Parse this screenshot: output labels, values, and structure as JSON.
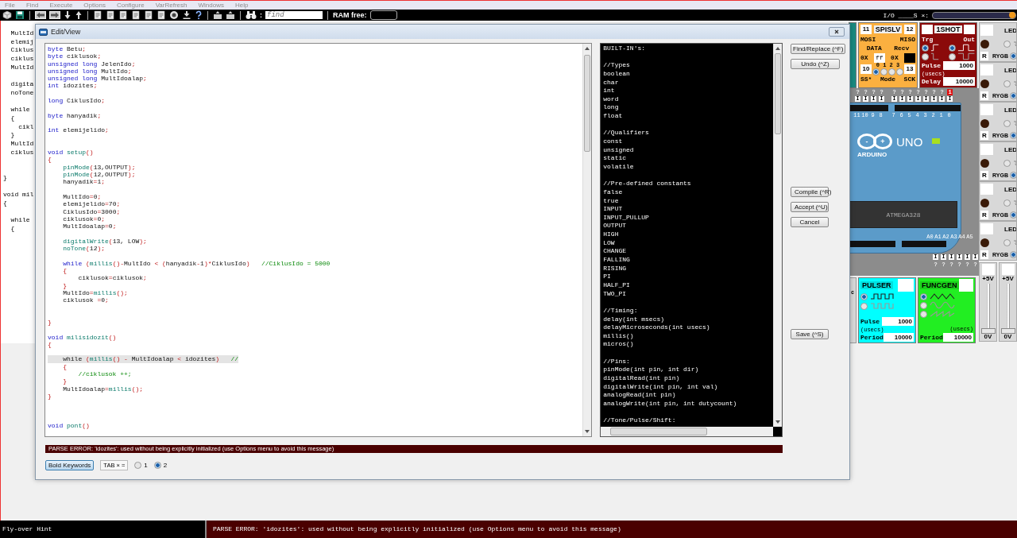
{
  "menu_bar": {
    "items": [
      {
        "label": "File",
        "disabled": true
      },
      {
        "label": "Find",
        "disabled": true
      },
      {
        "label": "Execute",
        "disabled": true
      },
      {
        "label": "Options",
        "disabled": true
      },
      {
        "label": "Configure",
        "disabled": true
      },
      {
        "label": "VarRefresh",
        "disabled": true
      },
      {
        "label": "Windows",
        "disabled": true
      },
      {
        "label": "Help",
        "disabled": true
      }
    ]
  },
  "toolbar": {
    "icons": [
      {
        "kind": "cube"
      },
      {
        "kind": "disk"
      },
      {
        "kind": "sep"
      },
      {
        "kind": "arrow-left"
      },
      {
        "kind": "arrow-right"
      },
      {
        "kind": "step-down"
      },
      {
        "kind": "step-up"
      },
      {
        "kind": "sep"
      },
      {
        "kind": "document"
      },
      {
        "kind": "document"
      },
      {
        "kind": "document"
      },
      {
        "kind": "document"
      },
      {
        "kind": "document"
      },
      {
        "kind": "document"
      },
      {
        "kind": "disc"
      },
      {
        "kind": "download"
      },
      {
        "kind": "help"
      },
      {
        "kind": "sep"
      },
      {
        "kind": "document-arrow"
      },
      {
        "kind": "document-arrow"
      },
      {
        "kind": "sep"
      },
      {
        "kind": "binoculars"
      }
    ],
    "find_colon": ":",
    "find_field": {
      "placeholder": "find"
    },
    "ram_label": "RAM free:",
    "io_label": "I/O ____S ×:",
    "io_slider": {
      "level": 1
    }
  },
  "background_code": {
    "lines": [
      {
        "kind": "code",
        "text": "  MultId"
      },
      {
        "kind": "code",
        "text": "  elemij"
      },
      {
        "kind": "code",
        "text": "  Ciklus"
      },
      {
        "kind": "code",
        "text": "  ciklus"
      },
      {
        "kind": "code",
        "text": "  MultId"
      },
      {
        "kind": "blank"
      },
      {
        "kind": "code",
        "text": "  digita"
      },
      {
        "kind": "code",
        "text": "  noTone"
      },
      {
        "kind": "blank"
      },
      {
        "kind": "code",
        "text": "  while"
      },
      {
        "kind": "code",
        "text": "  {"
      },
      {
        "kind": "code",
        "text": "    cikl"
      },
      {
        "kind": "code",
        "text": "  }"
      },
      {
        "kind": "code",
        "text": "  MultId"
      },
      {
        "kind": "code",
        "text": "  ciklus"
      },
      {
        "kind": "blank"
      },
      {
        "kind": "blank"
      },
      {
        "kind": "code",
        "text": "}"
      },
      {
        "kind": "blank"
      },
      {
        "kind": "code",
        "text": "void mil"
      },
      {
        "kind": "code",
        "text": "{"
      },
      {
        "kind": "blank"
      },
      {
        "kind": "code",
        "text": "  while"
      },
      {
        "kind": "code",
        "text": "  {"
      }
    ]
  },
  "edit_dialog": {
    "title": "Edit/View",
    "code_lines": [
      {
        "kind": "code",
        "current": false,
        "segments": [
          {
            "kind": "kw",
            "text": "byte"
          },
          {
            "kind": "tx",
            "text": " Betu"
          },
          {
            "kind": "op",
            "text": ";"
          }
        ]
      },
      {
        "kind": "code",
        "current": false,
        "segments": [
          {
            "kind": "kw",
            "text": "byte"
          },
          {
            "kind": "tx",
            "text": " ciklusok"
          },
          {
            "kind": "op",
            "text": ";"
          }
        ]
      },
      {
        "kind": "code",
        "current": false,
        "segments": [
          {
            "kind": "kw",
            "text": "unsigned long"
          },
          {
            "kind": "tx",
            "text": " JelenIdo"
          },
          {
            "kind": "op",
            "text": ";"
          }
        ]
      },
      {
        "kind": "code",
        "current": false,
        "segments": [
          {
            "kind": "kw",
            "text": "unsigned long"
          },
          {
            "kind": "tx",
            "text": " MultIdo"
          },
          {
            "kind": "op",
            "text": ";"
          }
        ]
      },
      {
        "kind": "code",
        "current": false,
        "segments": [
          {
            "kind": "kw",
            "text": "unsigned long"
          },
          {
            "kind": "tx",
            "text": " MultIdoalap"
          },
          {
            "kind": "op",
            "text": ";"
          }
        ]
      },
      {
        "kind": "code",
        "current": false,
        "segments": [
          {
            "kind": "kw",
            "text": "int"
          },
          {
            "kind": "tx",
            "text": " idozites"
          },
          {
            "kind": "op",
            "text": ";"
          }
        ]
      },
      {
        "kind": "blank"
      },
      {
        "kind": "code",
        "current": false,
        "segments": [
          {
            "kind": "kw",
            "text": "long"
          },
          {
            "kind": "tx",
            "text": " CiklusIdo"
          },
          {
            "kind": "op",
            "text": ";"
          }
        ]
      },
      {
        "kind": "blank"
      },
      {
        "kind": "code",
        "current": false,
        "segments": [
          {
            "kind": "kw",
            "text": "byte"
          },
          {
            "kind": "tx",
            "text": " hanyadik"
          },
          {
            "kind": "op",
            "text": ";"
          }
        ]
      },
      {
        "kind": "blank"
      },
      {
        "kind": "code",
        "current": false,
        "segments": [
          {
            "kind": "kw",
            "text": "int"
          },
          {
            "kind": "tx",
            "text": " elemijelido"
          },
          {
            "kind": "op",
            "text": ";"
          }
        ]
      },
      {
        "kind": "blank"
      },
      {
        "kind": "blank"
      },
      {
        "kind": "code",
        "current": false,
        "segments": [
          {
            "kind": "kw",
            "text": "void"
          },
          {
            "kind": "fn",
            "text": " setup"
          },
          {
            "kind": "op",
            "text": "()"
          }
        ]
      },
      {
        "kind": "code",
        "current": false,
        "segments": [
          {
            "kind": "op",
            "text": "{"
          }
        ]
      },
      {
        "kind": "code",
        "current": false,
        "segments": [
          {
            "kind": "fn",
            "text": "    pinMode"
          },
          {
            "kind": "op",
            "text": "("
          },
          {
            "kind": "tx",
            "text": "13,OUTPUT"
          },
          {
            "kind": "op",
            "text": ");"
          }
        ]
      },
      {
        "kind": "code",
        "current": false,
        "segments": [
          {
            "kind": "fn",
            "text": "    pinMode"
          },
          {
            "kind": "op",
            "text": "("
          },
          {
            "kind": "tx",
            "text": "12,OUTPUT"
          },
          {
            "kind": "op",
            "text": ");"
          }
        ]
      },
      {
        "kind": "code",
        "current": false,
        "segments": [
          {
            "kind": "tx",
            "text": "    hanyadik"
          },
          {
            "kind": "op",
            "text": "="
          },
          {
            "kind": "tx",
            "text": "1"
          },
          {
            "kind": "op",
            "text": ";"
          }
        ]
      },
      {
        "kind": "blank"
      },
      {
        "kind": "code",
        "current": false,
        "segments": [
          {
            "kind": "tx",
            "text": "    MultIdo"
          },
          {
            "kind": "op",
            "text": "="
          },
          {
            "kind": "tx",
            "text": "0"
          },
          {
            "kind": "op",
            "text": ";"
          }
        ]
      },
      {
        "kind": "code",
        "current": false,
        "segments": [
          {
            "kind": "tx",
            "text": "    elemijelido"
          },
          {
            "kind": "op",
            "text": "="
          },
          {
            "kind": "tx",
            "text": "70"
          },
          {
            "kind": "op",
            "text": ";"
          }
        ]
      },
      {
        "kind": "code",
        "current": false,
        "segments": [
          {
            "kind": "tx",
            "text": "    CiklusIdo"
          },
          {
            "kind": "op",
            "text": "="
          },
          {
            "kind": "tx",
            "text": "3000"
          },
          {
            "kind": "op",
            "text": ";"
          }
        ]
      },
      {
        "kind": "code",
        "current": false,
        "segments": [
          {
            "kind": "tx",
            "text": "    ciklusok"
          },
          {
            "kind": "op",
            "text": "="
          },
          {
            "kind": "tx",
            "text": "0"
          },
          {
            "kind": "op",
            "text": ";"
          }
        ]
      },
      {
        "kind": "code",
        "current": false,
        "segments": [
          {
            "kind": "tx",
            "text": "    MultIdoalap"
          },
          {
            "kind": "op",
            "text": "="
          },
          {
            "kind": "tx",
            "text": "0"
          },
          {
            "kind": "op",
            "text": ";"
          }
        ]
      },
      {
        "kind": "blank"
      },
      {
        "kind": "code",
        "current": false,
        "segments": [
          {
            "kind": "fn",
            "text": "    digitalWrite"
          },
          {
            "kind": "op",
            "text": "("
          },
          {
            "kind": "tx",
            "text": "13, LOW"
          },
          {
            "kind": "op",
            "text": ");"
          }
        ]
      },
      {
        "kind": "code",
        "current": false,
        "segments": [
          {
            "kind": "fn",
            "text": "    noTone"
          },
          {
            "kind": "op",
            "text": "("
          },
          {
            "kind": "tx",
            "text": "12"
          },
          {
            "kind": "op",
            "text": ");"
          }
        ]
      },
      {
        "kind": "blank"
      },
      {
        "kind": "code",
        "current": false,
        "segments": [
          {
            "kind": "kw",
            "text": "    while"
          },
          {
            "kind": "op",
            "text": " ("
          },
          {
            "kind": "fn",
            "text": "millis"
          },
          {
            "kind": "op",
            "text": "()-"
          },
          {
            "kind": "tx",
            "text": "MultIdo "
          },
          {
            "kind": "op",
            "text": "< ("
          },
          {
            "kind": "tx",
            "text": "hanyadik"
          },
          {
            "kind": "op",
            "text": "-"
          },
          {
            "kind": "tx",
            "text": "1"
          },
          {
            "kind": "op",
            "text": ")*"
          },
          {
            "kind": "tx",
            "text": "CiklusIdo"
          },
          {
            "kind": "op",
            "text": ")"
          },
          {
            "kind": "cm",
            "text": "   //CiklusIdo = 5000"
          }
        ]
      },
      {
        "kind": "code",
        "current": false,
        "segments": [
          {
            "kind": "op",
            "text": "    {"
          }
        ]
      },
      {
        "kind": "code",
        "current": false,
        "segments": [
          {
            "kind": "tx",
            "text": "        ciklusok"
          },
          {
            "kind": "op",
            "text": "="
          },
          {
            "kind": "tx",
            "text": "ciklusok"
          },
          {
            "kind": "op",
            "text": ";"
          }
        ]
      },
      {
        "kind": "code",
        "current": false,
        "segments": [
          {
            "kind": "op",
            "text": "    }"
          }
        ]
      },
      {
        "kind": "code",
        "current": false,
        "segments": [
          {
            "kind": "tx",
            "text": "    MultIdo"
          },
          {
            "kind": "op",
            "text": "="
          },
          {
            "kind": "fn",
            "text": "millis"
          },
          {
            "kind": "op",
            "text": "();"
          }
        ]
      },
      {
        "kind": "code",
        "current": false,
        "segments": [
          {
            "kind": "tx",
            "text": "    ciklusok "
          },
          {
            "kind": "op",
            "text": "="
          },
          {
            "kind": "tx",
            "text": "0"
          },
          {
            "kind": "op",
            "text": ";"
          }
        ]
      },
      {
        "kind": "blank"
      },
      {
        "kind": "blank"
      },
      {
        "kind": "code",
        "current": false,
        "segments": [
          {
            "kind": "op",
            "text": "}"
          }
        ]
      },
      {
        "kind": "blank"
      },
      {
        "kind": "code",
        "current": false,
        "segments": [
          {
            "kind": "kw",
            "text": "void"
          },
          {
            "kind": "fn",
            "text": " milisidozit"
          },
          {
            "kind": "op",
            "text": "()"
          }
        ]
      },
      {
        "kind": "code",
        "current": false,
        "segments": [
          {
            "kind": "op",
            "text": "{"
          }
        ]
      },
      {
        "kind": "blank"
      },
      {
        "kind": "code",
        "current": true,
        "segments": [
          {
            "kind": "tx",
            "text": "    while"
          },
          {
            "kind": "op",
            "text": " ("
          },
          {
            "kind": "fn",
            "text": "millis"
          },
          {
            "kind": "op",
            "text": "() - "
          },
          {
            "kind": "tx",
            "text": "MultIdoalap "
          },
          {
            "kind": "op",
            "text": "< "
          },
          {
            "kind": "tx",
            "text": "idozites"
          },
          {
            "kind": "op",
            "text": ")"
          },
          {
            "kind": "cm",
            "text": "   //"
          }
        ]
      },
      {
        "kind": "code",
        "current": false,
        "segments": [
          {
            "kind": "op",
            "text": "    {"
          }
        ]
      },
      {
        "kind": "code",
        "current": false,
        "segments": [
          {
            "kind": "cm",
            "text": "        //ciklusok ++;"
          }
        ]
      },
      {
        "kind": "code",
        "current": false,
        "segments": [
          {
            "kind": "op",
            "text": "    }"
          }
        ]
      },
      {
        "kind": "code",
        "current": false,
        "segments": [
          {
            "kind": "tx",
            "text": "    MultIdoalap"
          },
          {
            "kind": "op",
            "text": "="
          },
          {
            "kind": "fn",
            "text": "millis"
          },
          {
            "kind": "op",
            "text": "();"
          }
        ]
      },
      {
        "kind": "code",
        "current": false,
        "segments": [
          {
            "kind": "op",
            "text": "}"
          }
        ]
      },
      {
        "kind": "blank"
      },
      {
        "kind": "blank"
      },
      {
        "kind": "blank"
      },
      {
        "kind": "code",
        "current": false,
        "segments": [
          {
            "kind": "kw",
            "text": "void"
          },
          {
            "kind": "fn",
            "text": " pont"
          },
          {
            "kind": "op",
            "text": "()"
          }
        ]
      }
    ],
    "builtins": [
      {
        "kind": "text",
        "text": "BUILT-IN's:"
      },
      {
        "kind": "blank"
      },
      {
        "kind": "text",
        "text": "//Types"
      },
      {
        "kind": "text",
        "text": "boolean"
      },
      {
        "kind": "text",
        "text": "char"
      },
      {
        "kind": "text",
        "text": "int"
      },
      {
        "kind": "text",
        "text": "word"
      },
      {
        "kind": "text",
        "text": "long"
      },
      {
        "kind": "text",
        "text": "float"
      },
      {
        "kind": "blank"
      },
      {
        "kind": "text",
        "text": "//Qualifiers"
      },
      {
        "kind": "text",
        "text": "const"
      },
      {
        "kind": "text",
        "text": "unsigned"
      },
      {
        "kind": "text",
        "text": "static"
      },
      {
        "kind": "text",
        "text": "volatile"
      },
      {
        "kind": "blank"
      },
      {
        "kind": "text",
        "text": "//Pre-defined constants"
      },
      {
        "kind": "text",
        "text": "false"
      },
      {
        "kind": "text",
        "text": "true"
      },
      {
        "kind": "text",
        "text": "INPUT"
      },
      {
        "kind": "text",
        "text": "INPUT_PULLUP"
      },
      {
        "kind": "text",
        "text": "OUTPUT"
      },
      {
        "kind": "text",
        "text": "HIGH"
      },
      {
        "kind": "text",
        "text": "LOW"
      },
      {
        "kind": "text",
        "text": "CHANGE"
      },
      {
        "kind": "text",
        "text": "FALLING"
      },
      {
        "kind": "text",
        "text": "RISING"
      },
      {
        "kind": "text",
        "text": "PI"
      },
      {
        "kind": "text",
        "text": "HALF_PI"
      },
      {
        "kind": "text",
        "text": "TWO_PI"
      },
      {
        "kind": "blank"
      },
      {
        "kind": "text",
        "text": "//Timing:"
      },
      {
        "kind": "text",
        "text": "delay(int msecs)"
      },
      {
        "kind": "text",
        "text": "delayMicroseconds(int usecs)"
      },
      {
        "kind": "text",
        "text": "millis()"
      },
      {
        "kind": "text",
        "text": "micros()"
      },
      {
        "kind": "blank"
      },
      {
        "kind": "text",
        "text": "//Pins:"
      },
      {
        "kind": "text",
        "text": "pinMode(int pin, int dir)"
      },
      {
        "kind": "text",
        "text": "digitalRead(int pin)"
      },
      {
        "kind": "text",
        "text": "digitalWrite(int pin, int val)"
      },
      {
        "kind": "text",
        "text": "analogRead(int pin)"
      },
      {
        "kind": "text",
        "text": "analogWrite(int pin, int dutycount)"
      },
      {
        "kind": "blank"
      },
      {
        "kind": "text",
        "text": "//Tone/Pulse/Shift:"
      }
    ],
    "buttons": [
      {
        "kind": "top",
        "label": "Find/Replace (^F)"
      },
      {
        "kind": "top",
        "label": "Undo (^Z)"
      },
      {
        "kind": "middle",
        "label": "Compile (^R)"
      },
      {
        "kind": "middle",
        "label": "Accept (^U)"
      },
      {
        "kind": "middle",
        "label": "Cancel"
      },
      {
        "kind": "bottom",
        "label": "Save (^S)"
      }
    ],
    "parse_error": "PARSE ERROR: 'idozites': used without being explicitly initialized (use Options menu to avoid this message)",
    "bold_keywords_button": "Bold Keywords",
    "tab_label": "TAB × =",
    "tab_options": [
      {
        "label": "1",
        "selected": false
      },
      {
        "label": "2",
        "selected": true
      }
    ]
  },
  "devices": {
    "spislv": {
      "title": "SPISLV",
      "pin_mosi": "11",
      "pin_miso": "12",
      "mosi_label": "MOSI",
      "miso_label": "MISO",
      "data_label": "DATA",
      "recv_label": "Recv",
      "data_prefix": "0X",
      "data_value": "ff",
      "recv_prefix": "0X",
      "pin_ss": "10",
      "mode_numbers": "0 1 2 3",
      "pin_sck": "13",
      "ss_label": "SS*",
      "mode_label": "Mode",
      "sck_label": "SCK",
      "mode_options": [
        {
          "selected": true
        },
        {
          "selected": false
        },
        {
          "selected": false
        },
        {
          "selected": false
        }
      ]
    },
    "oneshot": {
      "title": "1SHOT",
      "trg_label": "Trg",
      "out_label": "Out",
      "trigger_options": [
        {
          "selected": true
        },
        {
          "selected": false
        }
      ],
      "output_options": [
        {
          "selected": true
        },
        {
          "selected": false
        }
      ],
      "pulse_label": "Pulse",
      "pulse_value": "1000",
      "units": "(usecs)",
      "delay_label": "Delay",
      "delay_value": "10000"
    },
    "board": {
      "top_pins": [
        {
          "value": "?",
          "mode": "I",
          "active": false
        },
        {
          "value": "?",
          "mode": "I",
          "active": false
        },
        {
          "value": "?",
          "mode": "I",
          "active": false
        },
        {
          "value": "?",
          "mode": "I",
          "active": false
        },
        {
          "value": "?",
          "mode": "I",
          "active": false
        },
        {
          "value": "?",
          "mode": "I",
          "active": false
        },
        {
          "value": "?",
          "mode": "I",
          "active": false
        },
        {
          "value": "?",
          "mode": "I",
          "active": false
        },
        {
          "value": "?",
          "mode": "I",
          "active": false
        },
        {
          "value": "?",
          "mode": "I",
          "active": false
        },
        {
          "value": "?",
          "mode": "I",
          "active": false
        },
        {
          "value": "1",
          "mode": "I",
          "active": true
        }
      ],
      "digital_labels": [
        "11",
        "10",
        "9",
        "8",
        "7",
        "6",
        "5",
        "4",
        "3",
        "2",
        "1",
        "0"
      ],
      "model": "UNO",
      "brand": "ARDUINO",
      "minus": "-",
      "plus": "+",
      "chip": "ATMEGA328",
      "analog_labels": [
        "A0",
        "A1",
        "A2",
        "A3",
        "A4",
        "A5"
      ],
      "bottom_pins": [
        {
          "value": "?",
          "mode": "I"
        },
        {
          "value": "?",
          "mode": "I"
        },
        {
          "value": "?",
          "mode": "I"
        },
        {
          "value": "?",
          "mode": "I"
        },
        {
          "value": "?",
          "mode": "I"
        },
        {
          "value": "?",
          "mode": "I"
        }
      ]
    },
    "partial_label": "c",
    "pulser": {
      "title": "PULSER",
      "wave_options": [
        {
          "kind": "pulse-high",
          "selected": true
        },
        {
          "kind": "pulse-low",
          "selected": false
        }
      ],
      "pulse_label": "Pulse",
      "pulse_value": "1000",
      "units": "(usecs)",
      "period_label": "Period",
      "period_value": "10000"
    },
    "funcgen": {
      "title": "FUNCGEN",
      "wave_options": [
        {
          "kind": "triangle",
          "selected": true
        },
        {
          "kind": "sine",
          "selected": false
        },
        {
          "kind": "sawtooth",
          "selected": false
        }
      ],
      "units": "(usecs)",
      "period_label": "Period",
      "period_value": "10000"
    },
    "leds": [
      {
        "title": "LED",
        "color_letter": "R",
        "colors": "RYGB",
        "polarity_options": [
          {
            "selected": false
          },
          {
            "selected": true
          }
        ]
      },
      {
        "title": "LED",
        "color_letter": "R",
        "colors": "RYGB",
        "polarity_options": [
          {
            "selected": false
          },
          {
            "selected": true
          }
        ]
      },
      {
        "title": "LED",
        "color_letter": "R",
        "colors": "RYGB",
        "polarity_options": [
          {
            "selected": false
          },
          {
            "selected": true
          }
        ]
      },
      {
        "title": "LED",
        "color_letter": "R",
        "colors": "RYGB",
        "polarity_options": [
          {
            "selected": false
          },
          {
            "selected": true
          }
        ]
      },
      {
        "title": "LED",
        "color_letter": "R",
        "colors": "RYGB",
        "polarity_options": [
          {
            "selected": false
          },
          {
            "selected": true
          }
        ]
      },
      {
        "title": "LED",
        "color_letter": "R",
        "colors": "RYGB",
        "polarity_options": [
          {
            "selected": false
          },
          {
            "selected": true
          }
        ]
      }
    ],
    "supplies": [
      {
        "top_label": "+5V",
        "bottom_label": "0V",
        "level": 0
      },
      {
        "top_label": "+5V",
        "bottom_label": "0V",
        "level": 0
      }
    ]
  },
  "status_bar": {
    "hint": "Fly-over Hint",
    "message": "PARSE ERROR: 'idozites': used without being explicitly initialized (use Options menu to avoid this message)"
  }
}
